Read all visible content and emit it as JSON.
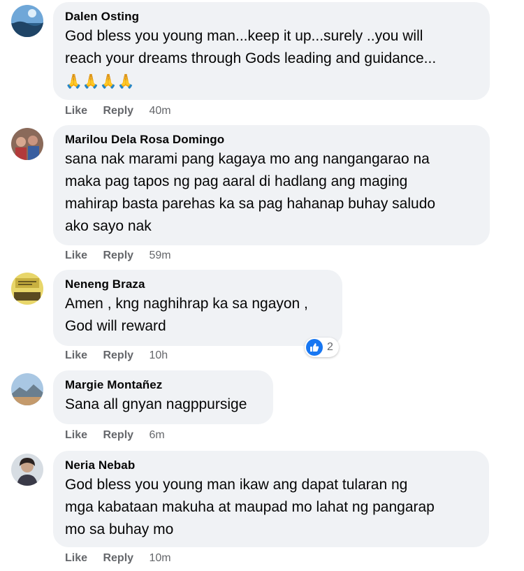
{
  "comments": [
    {
      "author": "Dalen Osting",
      "text": "God bless you young man...keep it up...surely ..you will\nreach your dreams through Gods leading and guidance...",
      "emoji": "🙏🙏🙏🙏",
      "like": "Like",
      "reply": "Reply",
      "time": "40m"
    },
    {
      "author": "Marilou Dela Rosa Domingo",
      "text": "sana nak marami pang kagaya mo ang nangangarao na\nmaka pag tapos ng pag aaral di hadlang ang maging\nmahirap basta parehas ka sa pag hahanap buhay saludo\nako sayo nak",
      "like": "Like",
      "reply": "Reply",
      "time": "59m"
    },
    {
      "author": "Neneng Braza",
      "text": "Amen , kng naghihrap ka sa ngayon ,\nGod will reward",
      "like": "Like",
      "reply": "Reply",
      "time": "10h",
      "reaction_count": "2",
      "reaction_icon": "thumbs-up-icon"
    },
    {
      "author": "Margie Montañez",
      "text": "Sana all gnyan nagppursige",
      "like": "Like",
      "reply": "Reply",
      "time": "6m"
    },
    {
      "author": "Neria Nebab",
      "text": "God bless you young man ikaw ang dapat tularan ng\nmga kabataan makuha at maupad mo lahat ng pangarap\nmo sa buhay mo",
      "like": "Like",
      "reply": "Reply",
      "time": "10m"
    }
  ],
  "colors": {
    "bubble": "#f0f2f5",
    "meta_text": "#65676b",
    "like_blue": "#1877f2"
  }
}
